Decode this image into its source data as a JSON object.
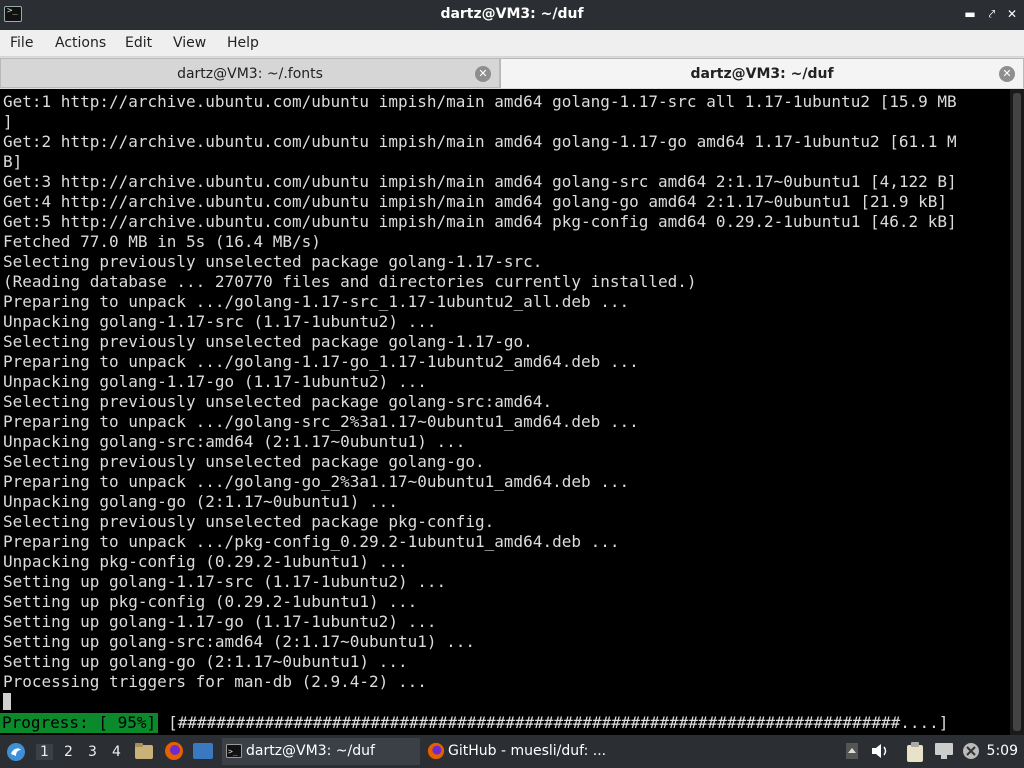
{
  "window": {
    "title": "dartz@VM3: ~/duf"
  },
  "menu": {
    "items": [
      "File",
      "Actions",
      "Edit",
      "View",
      "Help"
    ]
  },
  "tabs": [
    {
      "label": "dartz@VM3: ~/.fonts",
      "active": false
    },
    {
      "label": "dartz@VM3: ~/duf",
      "active": true
    }
  ],
  "terminal": {
    "lines": [
      "Get:1 http://archive.ubuntu.com/ubuntu impish/main amd64 golang-1.17-src all 1.17-1ubuntu2 [15.9 MB",
      "]",
      "Get:2 http://archive.ubuntu.com/ubuntu impish/main amd64 golang-1.17-go amd64 1.17-1ubuntu2 [61.1 M",
      "B]",
      "Get:3 http://archive.ubuntu.com/ubuntu impish/main amd64 golang-src amd64 2:1.17~0ubuntu1 [4,122 B]",
      "Get:4 http://archive.ubuntu.com/ubuntu impish/main amd64 golang-go amd64 2:1.17~0ubuntu1 [21.9 kB]",
      "Get:5 http://archive.ubuntu.com/ubuntu impish/main amd64 pkg-config amd64 0.29.2-1ubuntu1 [46.2 kB]",
      "Fetched 77.0 MB in 5s (16.4 MB/s)",
      "Selecting previously unselected package golang-1.17-src.",
      "(Reading database ... 270770 files and directories currently installed.)",
      "Preparing to unpack .../golang-1.17-src_1.17-1ubuntu2_all.deb ...",
      "Unpacking golang-1.17-src (1.17-1ubuntu2) ...",
      "Selecting previously unselected package golang-1.17-go.",
      "Preparing to unpack .../golang-1.17-go_1.17-1ubuntu2_amd64.deb ...",
      "Unpacking golang-1.17-go (1.17-1ubuntu2) ...",
      "Selecting previously unselected package golang-src:amd64.",
      "Preparing to unpack .../golang-src_2%3a1.17~0ubuntu1_amd64.deb ...",
      "Unpacking golang-src:amd64 (2:1.17~0ubuntu1) ...",
      "Selecting previously unselected package golang-go.",
      "Preparing to unpack .../golang-go_2%3a1.17~0ubuntu1_amd64.deb ...",
      "Unpacking golang-go (2:1.17~0ubuntu1) ...",
      "Selecting previously unselected package pkg-config.",
      "Preparing to unpack .../pkg-config_0.29.2-1ubuntu1_amd64.deb ...",
      "Unpacking pkg-config (0.29.2-1ubuntu1) ...",
      "Setting up golang-1.17-src (1.17-1ubuntu2) ...",
      "Setting up pkg-config (0.29.2-1ubuntu1) ...",
      "Setting up golang-1.17-go (1.17-1ubuntu2) ...",
      "Setting up golang-src:amd64 (2:1.17~0ubuntu1) ...",
      "Setting up golang-go (2:1.17~0ubuntu1) ...",
      "Processing triggers for man-db (2.9.4-2) ..."
    ],
    "progress_label": "Progress: [ 95%]",
    "progress_bar": "[###########################################################################....]",
    "progress_fraction": 0.95,
    "progress_color": "#0b8a2c"
  },
  "taskbar": {
    "start_icon": "start-menu-icon",
    "workspaces": [
      "1",
      "2",
      "3",
      "4"
    ],
    "active_workspace": "1",
    "tasks": [
      {
        "label": "dartz@VM3: ~/duf",
        "icon": "terminal-icon"
      },
      {
        "label": "GitHub - muesli/duf: ...",
        "icon": "firefox-icon"
      }
    ],
    "clock": "5:09"
  }
}
